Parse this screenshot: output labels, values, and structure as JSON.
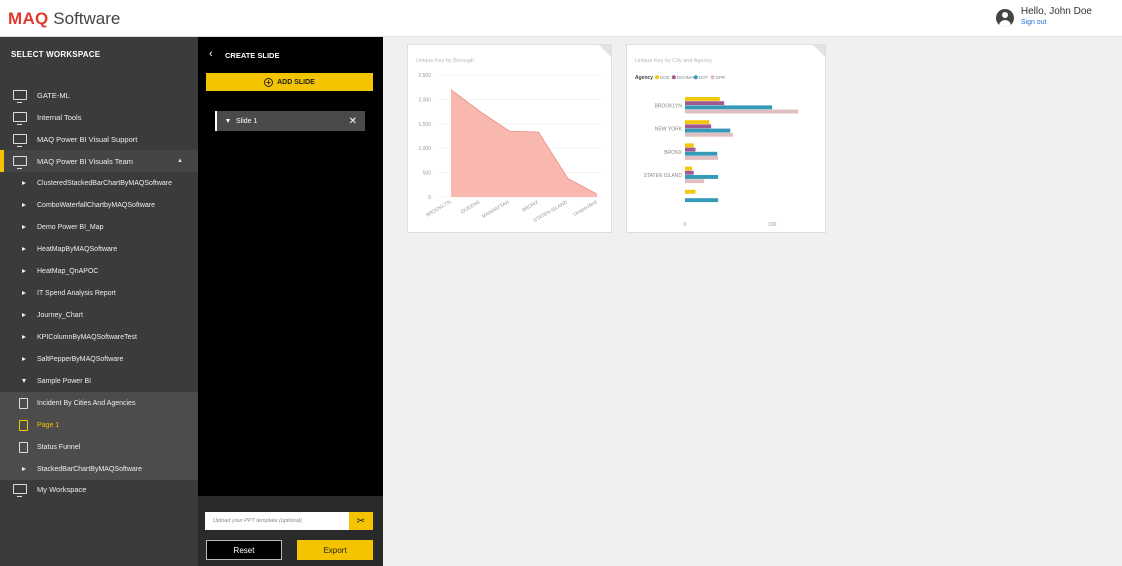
{
  "header": {
    "logo_brand": "MAQ",
    "logo_rest": " Software",
    "user_greeting": "Hello, John Doe",
    "sign_out": "Sign out"
  },
  "sidebar": {
    "title": "SELECT WORKSPACE",
    "workspaces": [
      {
        "label": "GATE-ML"
      },
      {
        "label": "Internal Tools"
      },
      {
        "label": "MAQ Power BI Visual Support"
      },
      {
        "label": "MAQ Power BI Visuals Team"
      }
    ],
    "reports": [
      {
        "label": "ClusteredStackedBarChartByMAQSoftware"
      },
      {
        "label": "ComboWaterfallChartbyMAQSoftware"
      },
      {
        "label": "Demo Power BI_Map"
      },
      {
        "label": "HeatMapByMAQSoftware"
      },
      {
        "label": "HeatMap_QnAPOC"
      },
      {
        "label": "IT Spend Analysis Report"
      },
      {
        "label": "Journey_Chart"
      },
      {
        "label": "KPIColumnByMAQSoftwareTest"
      },
      {
        "label": "SaltPepperByMAQSoftware"
      },
      {
        "label": "Sample Power BI"
      }
    ],
    "pages": [
      {
        "label": "Incident By Cities And Agencies"
      },
      {
        "label": "Page 1"
      },
      {
        "label": "Status Funnel"
      }
    ],
    "after_pages": {
      "label": "StackedBarChartByMAQSoftware"
    },
    "my_workspace": {
      "label": "My Workspace"
    }
  },
  "slide_panel": {
    "title": "CREATE SLIDE",
    "add_slide": "ADD SLIDE",
    "slides": [
      {
        "label": "Slide 1"
      }
    ],
    "upload_placeholder": "Upload your PPT template (optional)",
    "reset_label": "Reset",
    "export_label": "Export"
  },
  "chart_data": [
    {
      "type": "area",
      "title": "Unique Key by Borough",
      "categories": [
        "BROOKLYN",
        "QUEENS",
        "MANHATTAN",
        "BRONX",
        "STATEN ISLAND",
        "Unspecified"
      ],
      "values": [
        2200,
        1750,
        1350,
        1330,
        380,
        60
      ],
      "ylim": [
        0,
        2500
      ],
      "yticks": [
        "0",
        "500",
        "1,000",
        "1,500",
        "2,000",
        "2,500"
      ],
      "color": "#f8b8b0",
      "line_color": "#f08a80"
    },
    {
      "type": "bar",
      "title": "Unique Key by City and Agency",
      "legend_title": "Agency",
      "legend": [
        {
          "name": "DOE",
          "color": "#f2c80f"
        },
        {
          "name": "DOHMH",
          "color": "#a05a91"
        },
        {
          "name": "DOT",
          "color": "#3599b8"
        },
        {
          "name": "DPR",
          "color": "#dfbfbf"
        }
      ],
      "categories": [
        "BROOKLYN",
        "NEW YORK",
        "BRONX",
        "STATEN ISLAND",
        ""
      ],
      "series": [
        {
          "name": "DOE",
          "values": [
            40,
            28,
            10,
            8,
            12
          ]
        },
        {
          "name": "DOHMH",
          "values": [
            45,
            30,
            12,
            10,
            0
          ]
        },
        {
          "name": "DOT",
          "values": [
            100,
            52,
            37,
            38,
            38
          ]
        },
        {
          "name": "DPR",
          "values": [
            130,
            55,
            38,
            22,
            0
          ]
        }
      ],
      "xticks": [
        "0",
        "100"
      ],
      "xlim": [
        0,
        140
      ]
    }
  ]
}
